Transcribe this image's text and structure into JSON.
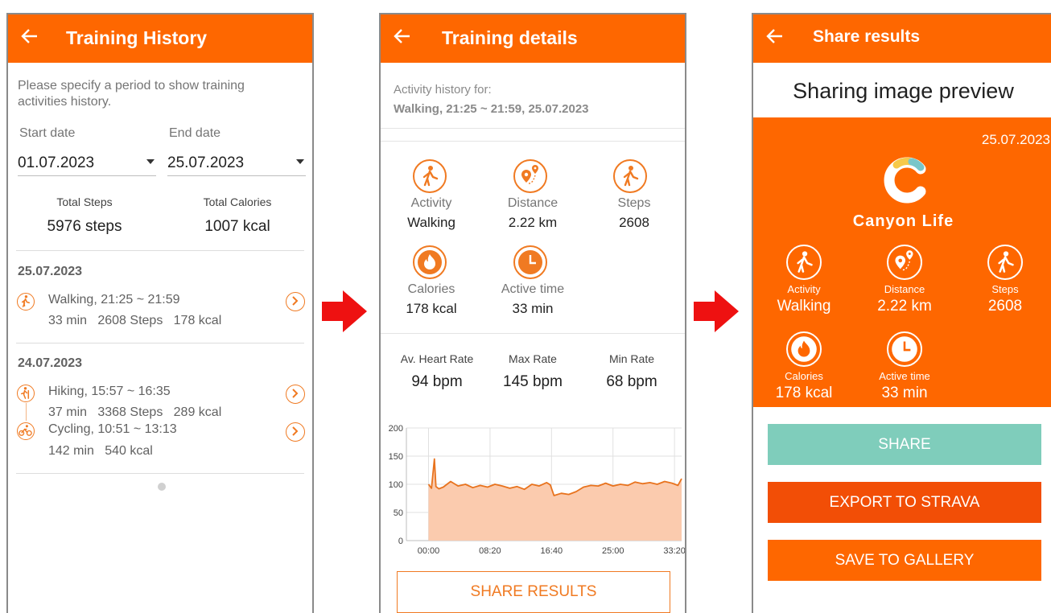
{
  "screen1": {
    "title": "Training History",
    "intro": "Please specify a period to show training activities history.",
    "intro_line1": "Please specify a period to show training",
    "intro_line2": "activities history.",
    "start_label": "Start date",
    "start_value": "01.07.2023",
    "end_label": "End date",
    "end_value": "25.07.2023",
    "total_steps_label": "Total Steps",
    "total_steps_value": "5976 steps",
    "total_cal_label": "Total Calories",
    "total_cal_value": "1007 kcal",
    "days": [
      {
        "date": "25.07.2023",
        "items": [
          {
            "icon": "walking-icon",
            "title": "Walking, 21:25 ~ 21:59",
            "details": "33 min   2608 Steps   178 kcal"
          }
        ]
      },
      {
        "date": "24.07.2023",
        "items": [
          {
            "icon": "hiking-icon",
            "title": "Hiking, 15:57 ~ 16:35",
            "details": "37 min   3368 Steps   289 kcal"
          },
          {
            "icon": "cycling-icon",
            "title": "Cycling, 10:51 ~ 13:13",
            "details": "142 min   540 kcal"
          }
        ]
      }
    ]
  },
  "screen2": {
    "title": "Training details",
    "history_label": "Activity history for:",
    "history_value": "Walking, 21:25 ~ 21:59, 25.07.2023",
    "stats": [
      {
        "icon": "walking-icon",
        "label": "Activity",
        "value": "Walking"
      },
      {
        "icon": "distance-pin-icon",
        "label": "Distance",
        "value": "2.22 km"
      },
      {
        "icon": "steps-icon",
        "label": "Steps",
        "value": "2608"
      },
      {
        "icon": "flame-icon",
        "label": "Calories",
        "value": "178 kcal"
      },
      {
        "icon": "clock-icon",
        "label": "Active time",
        "value": "33 min"
      }
    ],
    "rates": [
      {
        "label": "Av. Heart Rate",
        "value": "94 bpm"
      },
      {
        "label": "Max Rate",
        "value": "145 bpm"
      },
      {
        "label": "Min Rate",
        "value": "68 bpm"
      }
    ],
    "share_button": "SHARE RESULTS"
  },
  "chart_data": {
    "type": "area",
    "title": "",
    "xlabel": "",
    "ylabel": "",
    "x_ticks": [
      "00:00",
      "08:20",
      "16:40",
      "25:00",
      "33:20"
    ],
    "y_ticks": [
      "0",
      "50",
      "100",
      "150",
      "200"
    ],
    "ylim": [
      0,
      200
    ],
    "xlim_minutes": [
      -3,
      34.3
    ],
    "x_minutes": [
      0,
      0.4,
      0.8,
      1.0,
      1.4,
      2,
      3,
      4,
      5,
      6,
      7,
      8,
      9,
      10,
      11,
      12,
      13,
      14,
      15,
      16,
      16.5,
      17,
      18,
      19,
      20,
      21,
      22,
      23,
      24,
      25,
      26,
      27,
      28,
      29,
      30,
      31,
      32,
      33,
      33.8,
      34.3
    ],
    "series": [
      {
        "values": [
          100,
          93,
          145,
          96,
          92,
          95,
          105,
          97,
          100,
          94,
          98,
          95,
          100,
          97,
          93,
          96,
          91,
          100,
          97,
          103,
          99,
          80,
          84,
          82,
          87,
          95,
          98,
          97,
          102,
          97,
          100,
          98,
          104,
          101,
          103,
          100,
          105,
          102,
          98,
          110
        ]
      }
    ],
    "line_color": "#e8731e",
    "fill_color": "#fbcbae"
  },
  "screen3": {
    "title": "Share results",
    "preview_title": "Sharing image preview",
    "date": "25.07.2023",
    "brand": "Canyon Life",
    "stats": [
      {
        "icon": "walking-icon",
        "label": "Activity",
        "value": "Walking"
      },
      {
        "icon": "distance-pin-icon",
        "label": "Distance",
        "value": "2.22 km"
      },
      {
        "icon": "steps-icon",
        "label": "Steps",
        "value": "2608"
      },
      {
        "icon": "flame-icon",
        "label": "Calories",
        "value": "178 kcal"
      },
      {
        "icon": "clock-icon",
        "label": "Active time",
        "value": "33 min"
      }
    ],
    "share_button": "SHARE",
    "strava_button": "EXPORT TO STRAVA",
    "gallery_button": "SAVE TO GALLERY"
  },
  "colors": {
    "brand_orange": "#fe6700",
    "strava_orange": "#f24e06",
    "share_teal": "#7fcdbb",
    "arrow_red": "#ee1111"
  }
}
